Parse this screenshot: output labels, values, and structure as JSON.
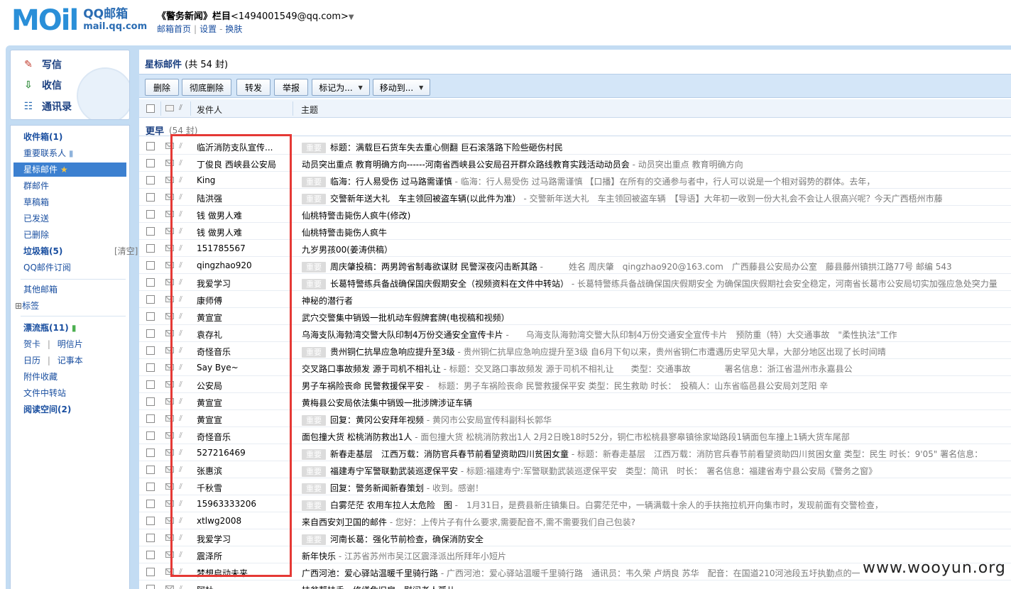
{
  "header": {
    "logo_text": "MOil",
    "logo_zh": "QQ邮箱",
    "logo_en": "mail.qq.com",
    "account_name": "《警务新闻》栏目",
    "account_email": "<1494001549@qq.com>",
    "links": [
      "邮箱首页",
      "设置",
      "换肤"
    ]
  },
  "actions": {
    "compose": "写信",
    "receive": "收信",
    "contacts": "通讯录"
  },
  "folders": {
    "inbox": "收件箱",
    "inbox_count": "(1)",
    "vip": "重要联系人",
    "starred": "星标邮件",
    "group": "群邮件",
    "drafts": "草稿箱",
    "sent": "已发送",
    "deleted": "已删除",
    "spam": "垃圾箱",
    "spam_count": "(5)",
    "spam_clear": "[清空]",
    "qq_subscribe": "QQ邮件订阅",
    "other_mail": "其他邮箱",
    "tags": "标签",
    "bottle": "漂流瓶",
    "bottle_count": "(11)",
    "cards": "贺卡",
    "postcards": "明信片",
    "calendar": "日历",
    "notes": "记事本",
    "attachments": "附件收藏",
    "file_transfer": "文件中转站",
    "reading": "阅读空间",
    "reading_count": "(2)"
  },
  "main": {
    "title": "星标邮件",
    "title_count": "(共 54 封)",
    "buttons": {
      "delete": "删除",
      "delete_permanent": "彻底删除",
      "forward": "转发",
      "report": "举报",
      "mark_as": "标记为...",
      "move_to": "移动到..."
    },
    "columns": {
      "sender": "发件人",
      "subject": "主题"
    },
    "group_label": "更早",
    "group_count": "(54 封)"
  },
  "emails": [
    {
      "sender": "临沂消防支队宣传...",
      "tag": "重要",
      "subject": "标题：满载巨石货车失去重心侧翻 巨石滚落路下险些砸伤村民",
      "preview": ""
    },
    {
      "sender": "丁俊良 西峡县公安局",
      "tag": "",
      "subject": "动员突出重点 教育明确方向------河南省西峡县公安局召开群众路线教育实践活动动员会",
      "preview": " - 动员突出重点 教育明确方向"
    },
    {
      "sender": "King",
      "tag": "重要",
      "subject": "临海：行人易受伤 过马路需谨慎",
      "preview": " - 临海：行人易受伤 过马路需谨慎 【口播】在所有的交通参与者中，行人可以说是一个相对弱势的群体。去年，"
    },
    {
      "sender": "陆洪强",
      "tag": "重要",
      "subject": "交警新年送大礼　车主领回被盗车辆(以此件为准）",
      "preview": " - 交警新年送大礼　车主领回被盗车辆　【导语】大年初一收到一份大礼会不会让人很高兴呢？今天广西梧州市藤"
    },
    {
      "sender": "钱 做男人难",
      "tag": "",
      "subject": "仙桃特警击毙伤人疯牛(修改)",
      "preview": ""
    },
    {
      "sender": "钱 做男人难",
      "tag": "",
      "subject": "仙桃特警击毙伤人疯牛",
      "preview": ""
    },
    {
      "sender": "151785567",
      "tag": "",
      "subject": "九岁男孩00(姜涛供稿）",
      "preview": ""
    },
    {
      "sender": "qingzhao920",
      "tag": "重要",
      "subject": "周庆肇投稿：两男跨省制毒欲谋财 民警深夜闪击断其路",
      "preview": " -　　　姓名 周庆肇　qingzhao920@163.com　广西藤县公安局办公室　藤县藤州镇拱江路77号 邮编 543"
    },
    {
      "sender": "我爱学习",
      "tag": "重要",
      "subject": "长葛特警练兵备战确保国庆假期安全（视频资料在文件中转站）",
      "preview": " - 长葛特警练兵备战确保国庆假期安全 为确保国庆假期社会安全稳定，河南省长葛市公安局切实加强应急处突力量"
    },
    {
      "sender": "康师傅",
      "tag": "",
      "subject": "神秘的潜行者",
      "preview": ""
    },
    {
      "sender": "黄宣宣",
      "tag": "",
      "subject": "武穴交警集中销毁一批机动车假牌套牌(电视稿和视频）",
      "preview": ""
    },
    {
      "sender": "袁存礼",
      "tag": "",
      "subject": "乌海支队海勃湾交警大队印制4万份交通安全宣传卡片",
      "preview": " -　　乌海支队海勃湾交警大队印制4万份交通安全宣传卡片　预防重（特）大交通事故　\"柔性执法\"工作"
    },
    {
      "sender": "奇怪音乐",
      "tag": "重要",
      "subject": "贵州铜仁抗旱应急响应提升至3级",
      "preview": " - 贵州铜仁抗旱应急响应提升至3级 自6月下旬以来，贵州省铜仁市遭遇历史罕见大旱，大部分地区出现了长时间晴"
    },
    {
      "sender": "Say Bye~",
      "tag": "",
      "subject": "交叉路口事故频发 源于司机不相礼让",
      "preview": " - 标题：交叉路口事故频发 源于司机不相礼让　　类型：交通事故　　　　署名信息：浙江省温州市永嘉县公"
    },
    {
      "sender": "公安局",
      "tag": "",
      "subject": "男子车祸险丧命 民警救援保平安",
      "preview": " -　标题：男子车祸险丧命 民警救援保平安 类型：民生救助 时长：　投稿人：山东省临邑县公安局刘芝阳 辛"
    },
    {
      "sender": "黄宣宣",
      "tag": "",
      "subject": "黄梅县公安局依法集中销毁一批涉牌涉证车辆",
      "preview": ""
    },
    {
      "sender": "黄宣宣",
      "tag": "重要",
      "subject": "回复：黄冈公安拜年视频",
      "preview": " - 黄冈市公安局宣传科副科长郭华"
    },
    {
      "sender": "奇怪音乐",
      "tag": "",
      "subject": "面包撞大货 松桃消防救出1人",
      "preview": " - 面包撞大货 松桃消防救出1人 2月2日晚18时52分，铜仁市松桃县寥皋镇徐家坳路段1辆面包车撞上1辆大货车尾部"
    },
    {
      "sender": "527216469",
      "tag": "重要",
      "subject": "新春走基层　江西万载：消防官兵春节前看望资助四川贫困女童",
      "preview": " - 标题：新春走基层　江西万载：消防官兵春节前看望资助四川贫困女童 类型：民生 时长：9'05\" 署名信息："
    },
    {
      "sender": "张惠滨",
      "tag": "重要",
      "subject": "福建寿宁军警联勤武装巡逻保平安",
      "preview": " - 标题:福建寿宁:军警联勤武装巡逻保平安　类型：简讯　时长：　署名信息：福建省寿宁县公安局《警务之窗》"
    },
    {
      "sender": "千秋雪",
      "tag": "重要",
      "subject": "回复：警务新闻新春策划",
      "preview": " - 收到。感谢！"
    },
    {
      "sender": "15963333206",
      "tag": "重要",
      "subject": "白雾茫茫 农用车拉人太危险　图",
      "preview": " -　1月31日，是费县新庄镇集日。白雾茫茫中，一辆满载十余人的手扶拖拉机开向集市时，发现前面有交警检查，"
    },
    {
      "sender": "xtlwg2008",
      "tag": "",
      "subject": "来自西安刘卫国的邮件",
      "preview": " - 您好：上传片子有什么要求,需要配音不,需不需要我们自己包装?"
    },
    {
      "sender": "我爱学习",
      "tag": "重要",
      "subject": "河南长葛：强化节前检查，确保消防安全",
      "preview": ""
    },
    {
      "sender": "震泽所",
      "tag": "",
      "subject": "新年快乐",
      "preview": " - 江苏省苏州市吴江区震泽派出所拜年小短片"
    },
    {
      "sender": "梦想启动未来",
      "tag": "",
      "subject": "广西河池：爱心驿站温暖千里骑行路",
      "preview": " - 广西河池：爱心驿站温暖千里骑行路　通讯员：韦久荣 卢炳良 苏华　配音：在国道210河池段五圩执勤点的一"
    },
    {
      "sender": "阿杜",
      "tag": "",
      "subject": "扶贫帮扶手　修缮危旧房　慰问老人孤儿",
      "preview": ""
    }
  ],
  "watermark": "www.wooyun.org"
}
